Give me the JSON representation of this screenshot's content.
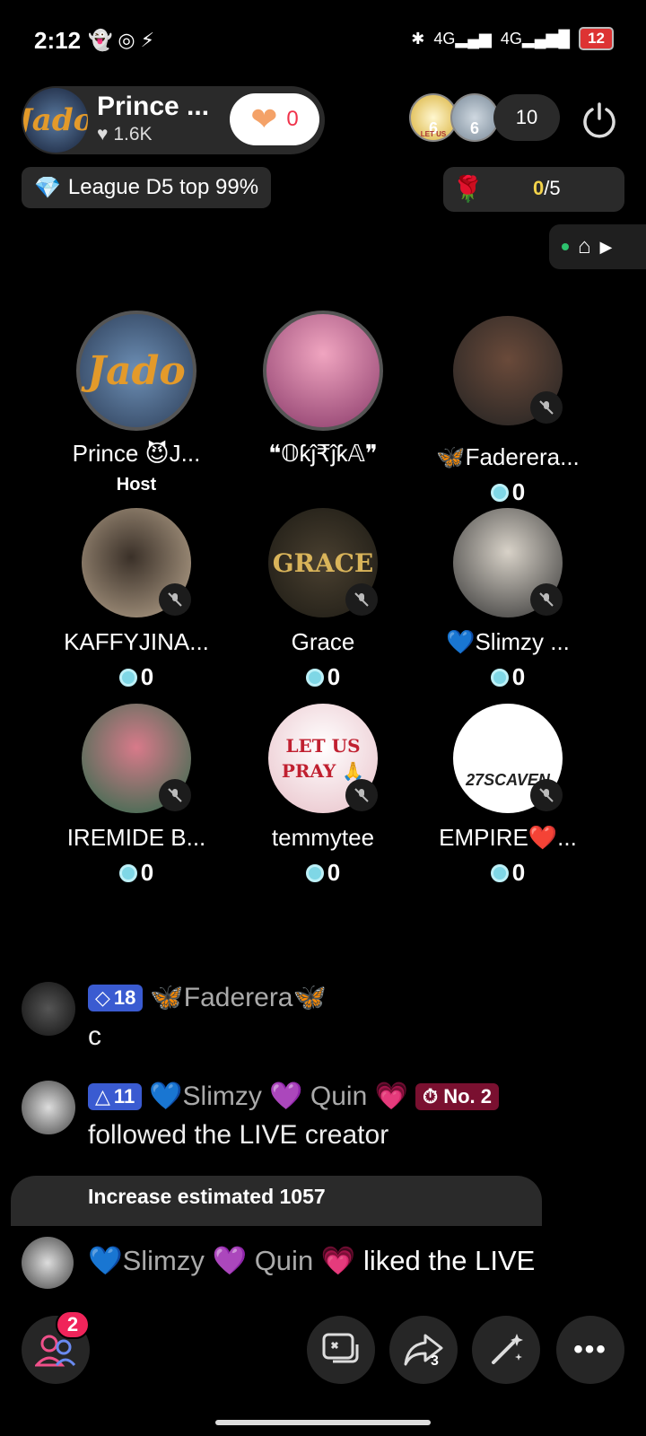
{
  "status_bar": {
    "time": "2:12",
    "network1": "4G",
    "network2": "4G",
    "battery": "12"
  },
  "host": {
    "name": "Prince ...",
    "likes": "1.6K",
    "heart_count": "0",
    "avatar_text": "Jado"
  },
  "viewers": {
    "avatar1_label": "LET US",
    "avatar1_rank": "6",
    "avatar2_rank": "6",
    "count": "10"
  },
  "league": {
    "text": "League D5 top 99%"
  },
  "rose_goal": {
    "current": "0",
    "total": "/5"
  },
  "seats": [
    {
      "name": "Prince 😈J...",
      "sub": "Host",
      "score": "",
      "avatar_text": "Jado"
    },
    {
      "name": "❝𝕆ƙĵ₹ĵƙ𝔸❞",
      "sub": "",
      "score": ""
    },
    {
      "name": "🦋Faderera...",
      "sub": "",
      "score": "0"
    },
    {
      "name": "KAFFYJINA...",
      "sub": "",
      "score": "0"
    },
    {
      "name": "Grace",
      "sub": "",
      "score": "0",
      "avatar_text": "GRACE"
    },
    {
      "name": "💙Slimzy ...",
      "sub": "",
      "score": "0"
    },
    {
      "name": "IREMIDE B...",
      "sub": "",
      "score": "0"
    },
    {
      "name": "temmytee",
      "sub": "",
      "score": "0",
      "avatar_text": "LET US PRAY 🙏"
    },
    {
      "name": "EMPIRE❤️...",
      "sub": "",
      "score": "0",
      "avatar_text": "27SCAVEN"
    }
  ],
  "chat": [
    {
      "level": "18",
      "user": "🦋Faderera🦋",
      "text": "c"
    },
    {
      "level": "11",
      "user": "💙Slimzy 💜 Quin 💗",
      "badge": "No. 2",
      "text": "followed the LIVE creator"
    }
  ],
  "banner": {
    "text": "Increase estimated 1057"
  },
  "liked": {
    "user": "💙Slimzy 💜 Quin 💗",
    "action": "liked the LIVE"
  },
  "bottom_bar": {
    "guests_badge": "2",
    "share_count": "3"
  },
  "colors": {
    "background": "#000000",
    "pill": "#2a2a2a",
    "accent_red": "#f0245a",
    "gold": "#f3d34a",
    "level_blue": "#3a5bd1"
  }
}
